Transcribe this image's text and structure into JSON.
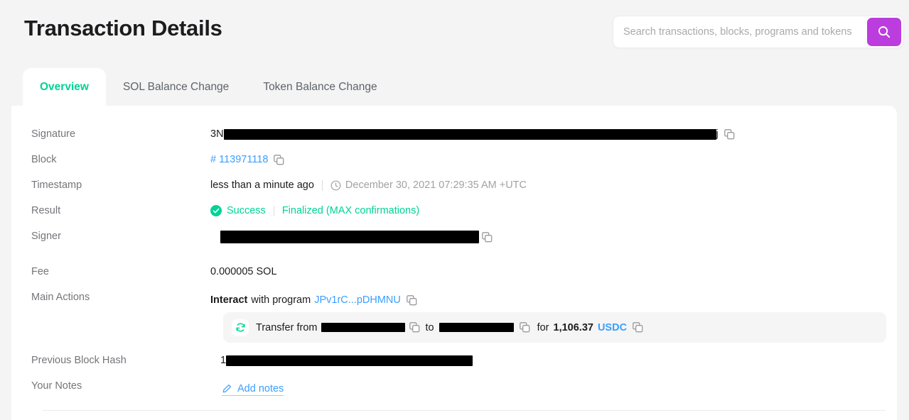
{
  "header": {
    "title": "Transaction Details",
    "search": {
      "placeholder": "Search transactions, blocks, programs and tokens",
      "value": "",
      "button_icon": "search-icon"
    }
  },
  "tabs": [
    {
      "label": "Overview",
      "active": true
    },
    {
      "label": "SOL Balance Change",
      "active": false
    },
    {
      "label": "Token Balance Change",
      "active": false
    }
  ],
  "details": {
    "signature": {
      "label": "Signature",
      "prefix": "3N",
      "redacted": true,
      "suffix": "j",
      "copy_icon": "copy-icon"
    },
    "block": {
      "label": "Block",
      "value": "# 113971118",
      "copy_icon": "copy-icon"
    },
    "timestamp": {
      "label": "Timestamp",
      "relative": "less than a minute ago",
      "clock_icon": "clock-icon",
      "absolute": "December 30, 2021 07:29:35 AM +UTC"
    },
    "result": {
      "label": "Result",
      "check_icon": "check-circle-icon",
      "status": "Success",
      "confirmations": "Finalized (MAX confirmations)"
    },
    "signer": {
      "label": "Signer",
      "redacted": true,
      "copy_icon": "copy-icon"
    },
    "fee": {
      "label": "Fee",
      "value": "0.000005 SOL"
    },
    "main_actions": {
      "label": "Main Actions",
      "interact_word": "Interact",
      "with_program": "with program",
      "program": "JPv1rC...pDHMNU",
      "copy_icon": "copy-icon",
      "transfer": {
        "swap_icon": "swap-icon",
        "transfer_from": "Transfer from",
        "from_redacted": true,
        "to_word": "to",
        "to_redacted": true,
        "to_copy_icon": "copy-icon",
        "for_word": "for",
        "amount": "1,106.37",
        "token": "USDC",
        "amount_copy_icon": "copy-icon"
      }
    },
    "previous_block_hash": {
      "label": "Previous Block Hash",
      "prefix": "1",
      "redacted": true
    },
    "your_notes": {
      "label": "Your Notes",
      "pencil_icon": "pencil-icon",
      "add_notes": "Add notes"
    }
  },
  "colors": {
    "accent_teal": "#00d395",
    "link_blue": "#3b9eff",
    "search_purple": "#bc3ddd",
    "page_bg": "#f4f4f5"
  }
}
